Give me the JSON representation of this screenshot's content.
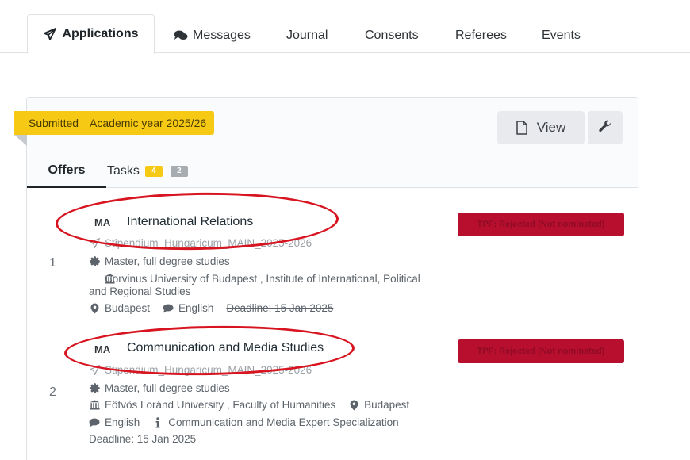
{
  "nav": {
    "tabs": [
      {
        "label": "Applications",
        "icon": "paper-plane-icon",
        "active": true
      },
      {
        "label": "Messages",
        "icon": "comments-icon"
      },
      {
        "label": "Journal"
      },
      {
        "label": "Consents"
      },
      {
        "label": "Referees"
      },
      {
        "label": "Events"
      }
    ]
  },
  "application": {
    "status_label": "Submitted",
    "year_label": "Academic year 2025/26",
    "view_button": "View",
    "subtabs": {
      "offers": "Offers",
      "tasks": "Tasks",
      "tasks_badge_open": "4",
      "tasks_badge_done": "2"
    }
  },
  "offers": [
    {
      "number": "1",
      "degree": "MA",
      "title": "International Relations",
      "status": "TPF: Rejected (Not nominated)",
      "scholarship": "Stipendium_Hungaricum_MAIN_2025-2026",
      "study_type": "Master, full degree studies",
      "institution": "Corvinus University of Budapest , Institute of International, Political and Regional Studies",
      "city": "Budapest",
      "language": "English",
      "deadline": "Deadline: 15 Jan 2025"
    },
    {
      "number": "2",
      "degree": "MA",
      "title": "Communication and Media Studies",
      "status": "TPF: Rejected (Not nominated)",
      "scholarship": "Stipendium_Hungaricum_MAIN_2025-2026",
      "study_type": "Master, full degree studies",
      "institution": "Eötvös Loránd University , Faculty of Humanities",
      "city": "Budapest",
      "language": "English",
      "specialization": "Communication and Media Expert Specialization",
      "deadline": "Deadline: 15 Jan 2025"
    }
  ],
  "colors": {
    "ribbon": "#f6c915",
    "status_rejected": "#b80f2f",
    "annotation_circle": "#d7141f"
  }
}
